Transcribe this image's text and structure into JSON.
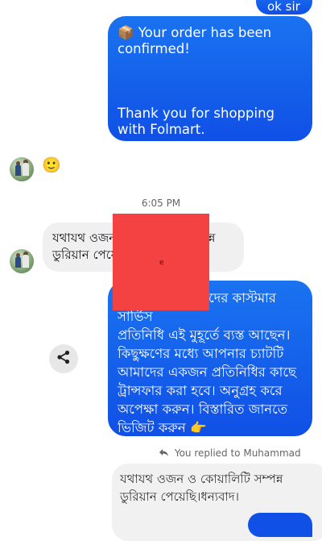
{
  "top_message": {
    "text": "ok sir"
  },
  "order_message": {
    "line1": "📦 Your order has been confirmed!",
    "line2": "Thank you for shopping with Folmart."
  },
  "reaction": {
    "emoji": "🙂"
  },
  "timestamp": "6:05 PM",
  "incoming_message": {
    "line1": "যথাযথ ওজন ও কোয়ালিটি সম্পন্ন",
    "line2": "ডুরিয়ান পেয়েছি।ধন্যবাদ।"
  },
  "support_message": {
    "line1": "প্রিয় গ্রাহক, আমাদের কাস্টমার সার্ভিস",
    "line2": "প্রতিনিধি এই মুহূর্তে ব্যস্ত আছেন।",
    "line3": "কিছুক্ষণের মধ্যে আপনার চ্যাটটি",
    "line4": "আমাদের একজন প্রতিনিধির কাছে",
    "line5": "ট্রান্সফার করা হবে। অনুগ্রহ করে",
    "line6": "অপেক্ষা করুন। বিস্তারিত জানতে",
    "line7": "ভিজিট করুন 👉",
    "link": "www.folmart.com"
  },
  "overlay": {
    "mark": "e",
    "color": "#f44141"
  },
  "reply_info": {
    "text": "You replied to Muhammad"
  },
  "quoted_message": {
    "line1": "যথাযথ ওজন ও কোয়ালিটি সম্পন্ন",
    "line2": "ডুরিয়ান পেয়েছি।ধন্যবাদ।"
  },
  "colors": {
    "outgoing_bubble": "#1050e6",
    "incoming_bubble": "#f0f0f0",
    "share_button": "#e7e7e7"
  },
  "icons": {
    "share": "share-icon",
    "reply": "reply-arrow-icon"
  }
}
